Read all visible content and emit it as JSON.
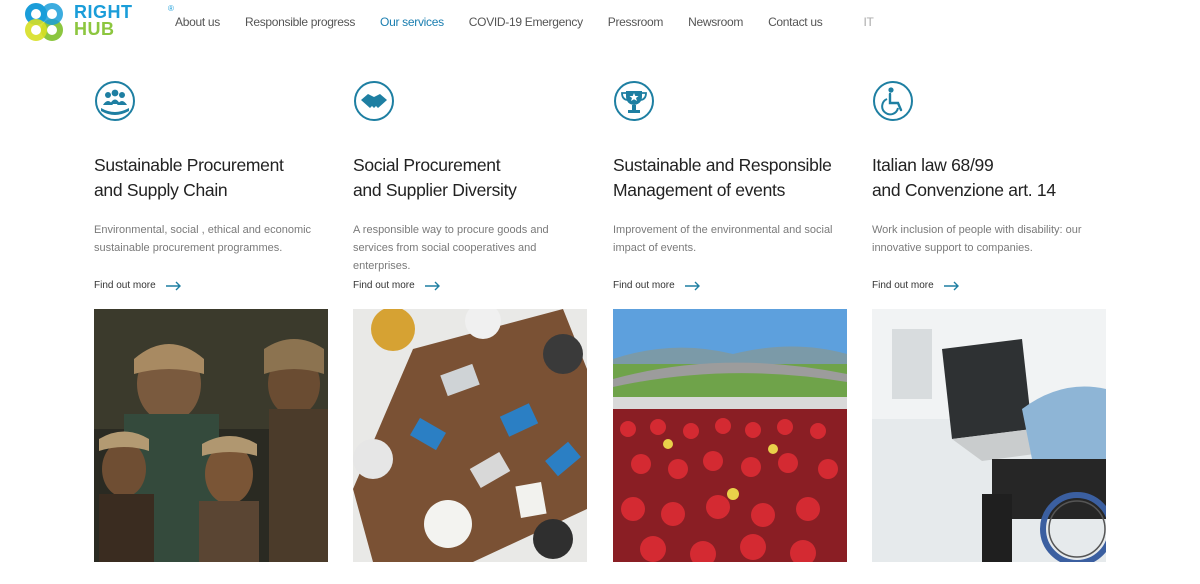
{
  "brand": {
    "line1": "RIGHT",
    "line2": "HUB",
    "reg": "®"
  },
  "nav": [
    {
      "label": "About us",
      "active": false
    },
    {
      "label": "Responsible progress",
      "active": false
    },
    {
      "label": "Our services",
      "active": true
    },
    {
      "label": "COVID-19 Emergency",
      "active": false
    },
    {
      "label": "Pressroom",
      "active": false
    },
    {
      "label": "Newsroom",
      "active": false
    },
    {
      "label": "Contact us",
      "active": false
    }
  ],
  "language": "IT",
  "colors": {
    "accent": "#1a7eb0",
    "brand_blue": "#1a9dd9",
    "brand_green": "#8cc63f",
    "icon_teal": "#1e7fa2"
  },
  "services": [
    {
      "icon": "team-hand-icon",
      "title_line1": "Sustainable Procurement",
      "title_line2": "and Supply Chain",
      "description": "Environmental, social , ethical and economic sustainable procurement programmes.",
      "link": "Find out more",
      "image": "children-photo"
    },
    {
      "icon": "handshake-icon",
      "title_line1": "Social Procurement",
      "title_line2": "and Supplier Diversity",
      "description": "A responsible way to procure goods and services from social cooperatives and enterprises.",
      "link": "Find out more",
      "image": "meeting-table-photo"
    },
    {
      "icon": "trophy-icon",
      "title_line1": "Sustainable and Responsible",
      "title_line2": "Management of events",
      "description": "Improvement of the environmental and social impact of events.",
      "link": "Find out more",
      "image": "racetrack-crowd-photo"
    },
    {
      "icon": "wheelchair-icon",
      "title_line1": "Italian law 68/99",
      "title_line2": "and Convenzione art. 14",
      "description": "Work inclusion of people with disability: our innovative support to companies.",
      "link": "Find out more",
      "image": "wheelchair-laptop-photo"
    }
  ]
}
